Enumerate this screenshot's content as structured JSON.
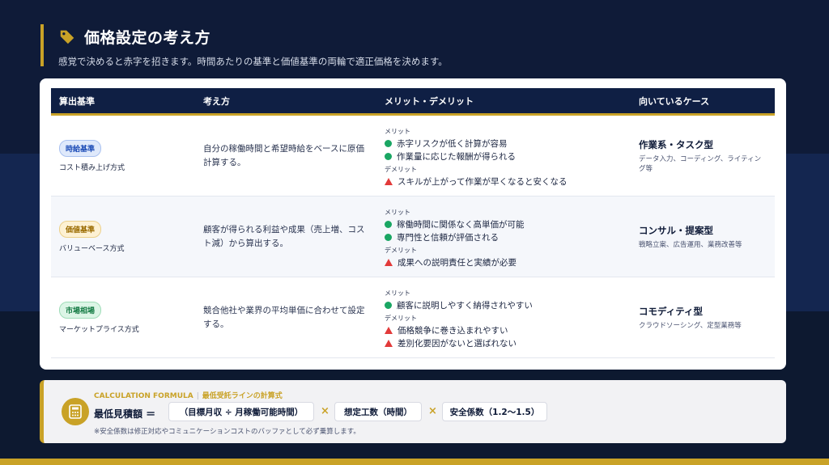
{
  "header": {
    "title": "価格設定の考え方",
    "subtitle": "感覚で決めると赤字を招きます。時間あたりの基準と価値基準の両輪で適正価格を決めます。",
    "icon": "tag-icon"
  },
  "table": {
    "headers": [
      "算出基準",
      "考え方",
      "メリット・デメリット",
      "向いているケース"
    ],
    "merit_label": "メリット",
    "demerit_label": "デメリット",
    "rows": [
      {
        "badge": "時給基準",
        "badge_color": "#1e4db7",
        "basis_sub": "コスト積み上げ方式",
        "description": "自分の稼働時間と希望時給をベースに原価計算する。",
        "merits": [
          "赤字リスクが低く計算が容易",
          "作業量に応じた報酬が得られる"
        ],
        "demerits": [
          "スキルが上がって作業が早くなると安くなる"
        ],
        "case_title": "作業系・タスク型",
        "case_sub": "データ入力、コーディング、ライティング等"
      },
      {
        "badge": "価値基準",
        "badge_color": "#9a6b00",
        "basis_sub": "バリューベース方式",
        "description": "顧客が得られる利益や成果（売上増、コスト減）から算出する。",
        "merits": [
          "稼働時間に関係なく高単価が可能",
          "専門性と信頼が評価される"
        ],
        "demerits": [
          "成果への説明責任と実績が必要"
        ],
        "case_title": "コンサル・提案型",
        "case_sub": "戦略立案、広告運用、業務改善等"
      },
      {
        "badge": "市場相場",
        "badge_color": "#137a43",
        "basis_sub": "マーケットプライス方式",
        "description": "競合他社や業界の平均単価に合わせて設定する。",
        "merits": [
          "顧客に説明しやすく納得されやすい"
        ],
        "demerits": [
          "価格競争に巻き込まれやすい",
          "差別化要因がないと選ばれない"
        ],
        "case_title": "コモディティ型",
        "case_sub": "クラウドソーシング、定型業務等"
      }
    ]
  },
  "formula": {
    "heading_en": "CALCULATION FORMULA",
    "heading_jp": "最低受託ラインの計算式",
    "label": "最低見積額 ＝",
    "term1": "（目標月収 ÷ 月稼働可能時間）",
    "term2": "想定工数（時間）",
    "term3": "安全係数（1.2〜1.5）",
    "times": "×",
    "note": "※安全係数は修正対応やコミュニケーションコストのバッファとして必ず乗算します。",
    "icon": "calculator-icon"
  },
  "colors": {
    "accent": "#c9a227",
    "navy": "#0f1f44",
    "merit": "#1aa663",
    "demerit": "#e23a3a"
  }
}
